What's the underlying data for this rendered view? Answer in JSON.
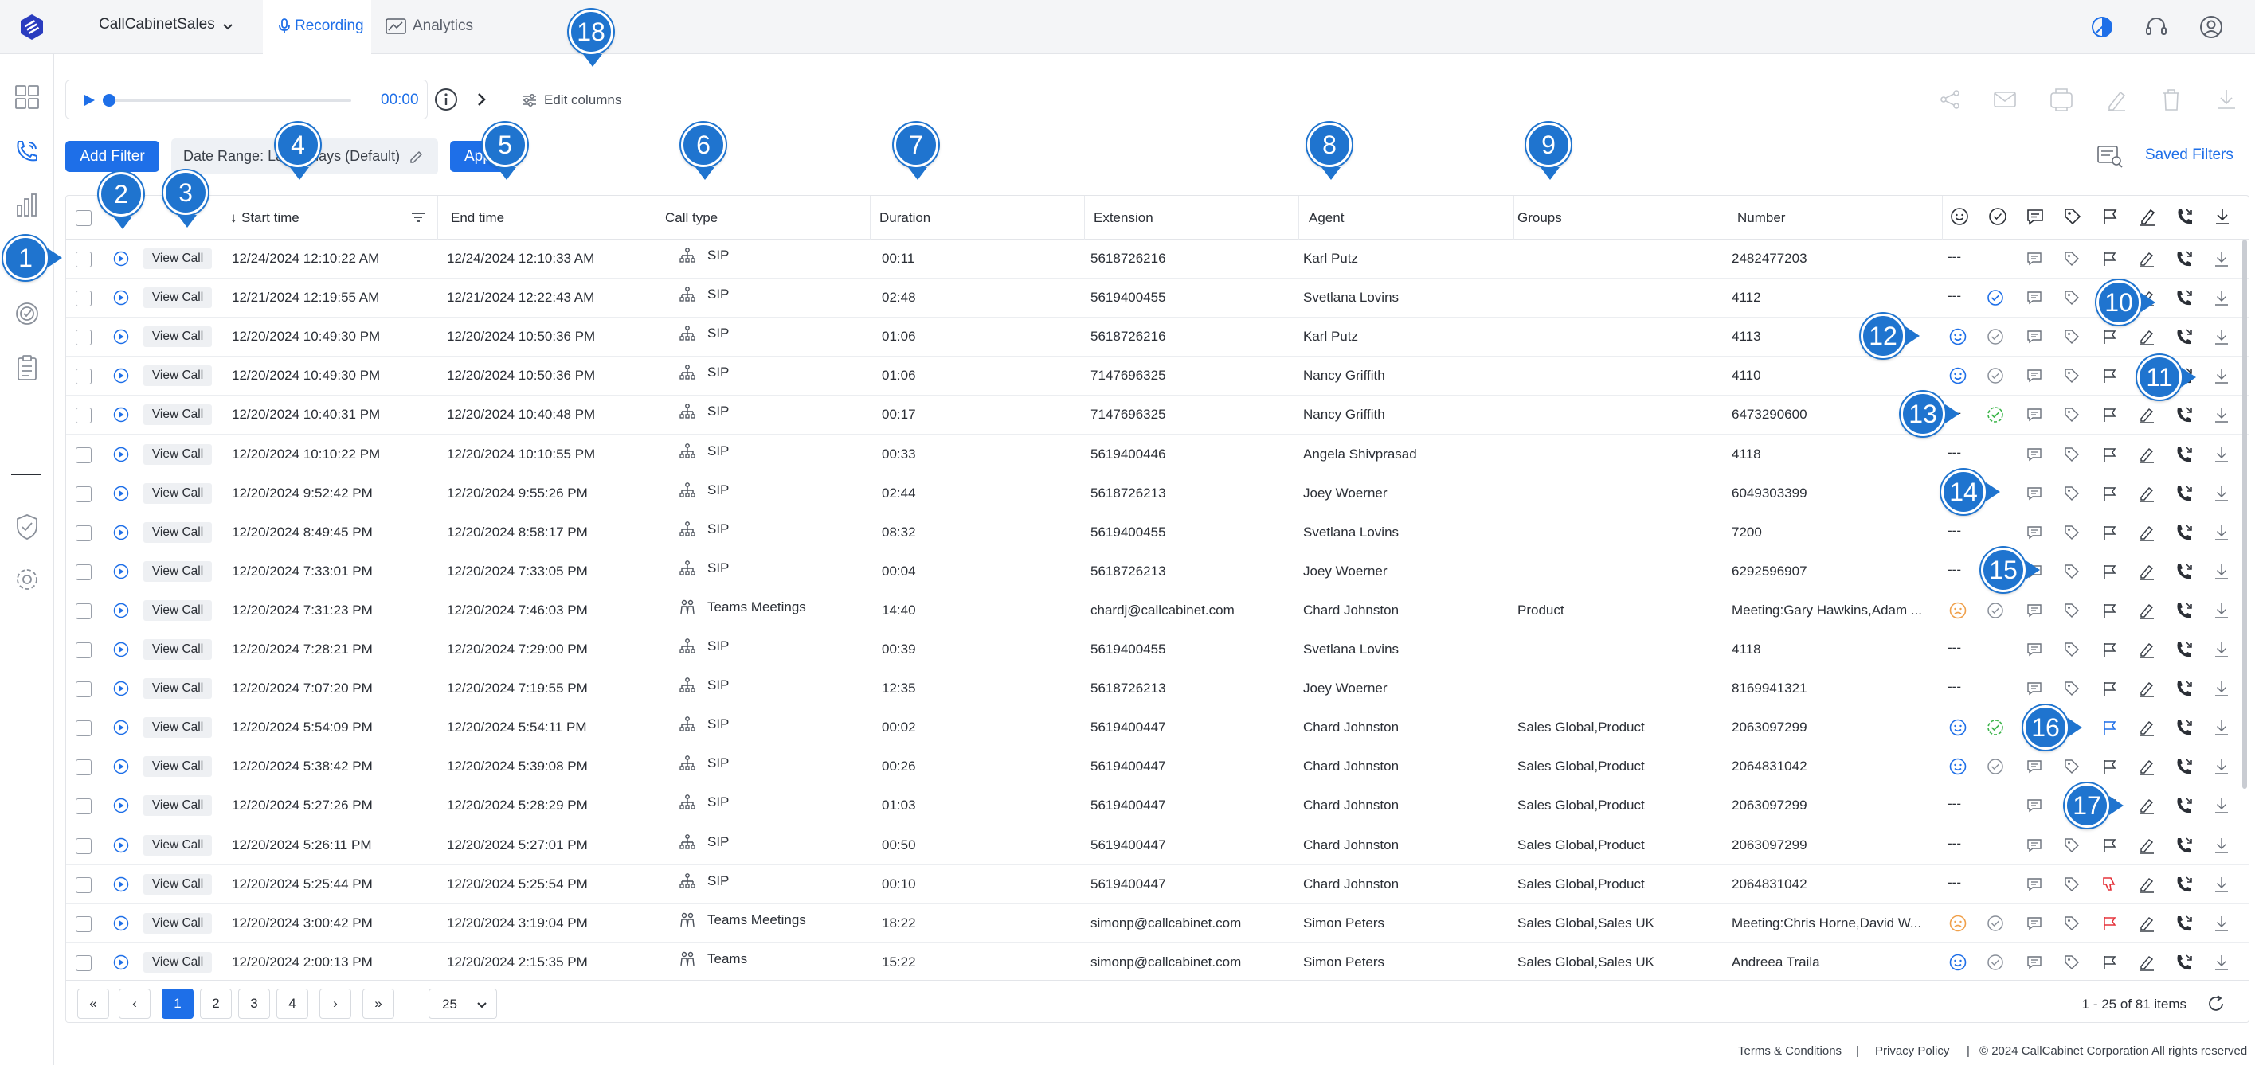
{
  "topbar": {
    "org_name": "CallCabinetSales",
    "tabs": [
      {
        "label": "Recording",
        "active": true
      },
      {
        "label": "Analytics",
        "active": false
      }
    ],
    "right_icons": [
      "theme-toggle-icon",
      "headset-icon",
      "user-account-icon"
    ]
  },
  "sidenav": {
    "items": [
      "dashboard-grid-icon",
      "calls-icon",
      "bar-chart-icon",
      "waveform-icon",
      "quality-check-icon",
      "clipboard-icon",
      "divider",
      "shield-check-icon",
      "settings-gear-icon"
    ]
  },
  "player": {
    "time": "00:00"
  },
  "toolbar": {
    "edit_columns": "Edit columns",
    "action_icons": [
      "share-icon",
      "email-icon",
      "export-xlsx-icon",
      "annotate-icon",
      "delete-icon",
      "download-icon"
    ]
  },
  "filters": {
    "add_filter": "Add Filter",
    "date_range": "Date Range: Last 7 days (Default)",
    "apply": "Apply",
    "saved_filters": "Saved Filters"
  },
  "table": {
    "columns": [
      "Start time",
      "End time",
      "Call type",
      "Duration",
      "Extension",
      "Agent",
      "Groups",
      "Number"
    ],
    "sort_indicator": "↓",
    "rows": [
      {
        "start": "12/24/2024 12:10:22 AM",
        "end": "12/24/2024 12:10:33 AM",
        "type": "SIP",
        "duration": "00:11",
        "extension": "5618726216",
        "agent": "Karl Putz",
        "groups": "",
        "number": "2482477203",
        "sentiment": "",
        "status": "none"
      },
      {
        "start": "12/21/2024 12:19:55 AM",
        "end": "12/21/2024 12:22:43 AM",
        "type": "SIP",
        "duration": "02:48",
        "extension": "5619400455",
        "agent": "Svetlana Lovins",
        "groups": "",
        "number": "4112",
        "sentiment": "",
        "status": "blue"
      },
      {
        "start": "12/20/2024 10:49:30 PM",
        "end": "12/20/2024 10:50:36 PM",
        "type": "SIP",
        "duration": "01:06",
        "extension": "5618726216",
        "agent": "Karl Putz",
        "groups": "",
        "number": "4113",
        "sentiment": "neutral",
        "status": "grey"
      },
      {
        "start": "12/20/2024 10:49:30 PM",
        "end": "12/20/2024 10:50:36 PM",
        "type": "SIP",
        "duration": "01:06",
        "extension": "7147696325",
        "agent": "Nancy Griffith",
        "groups": "",
        "number": "4110",
        "sentiment": "neutral",
        "status": "grey"
      },
      {
        "start": "12/20/2024 10:40:31 PM",
        "end": "12/20/2024 10:40:48 PM",
        "type": "SIP",
        "duration": "00:17",
        "extension": "7147696325",
        "agent": "Nancy Griffith",
        "groups": "",
        "number": "6473290600",
        "sentiment": "",
        "status": "green"
      },
      {
        "start": "12/20/2024 10:10:22 PM",
        "end": "12/20/2024 10:10:55 PM",
        "type": "SIP",
        "duration": "00:33",
        "extension": "5619400446",
        "agent": "Angela Shivprasad",
        "groups": "",
        "number": "4118",
        "sentiment": "",
        "status": "none"
      },
      {
        "start": "12/20/2024 9:52:42 PM",
        "end": "12/20/2024 9:55:26 PM",
        "type": "SIP",
        "duration": "02:44",
        "extension": "5618726213",
        "agent": "Joey Woerner",
        "groups": "",
        "number": "6049303399",
        "sentiment": "",
        "status": "none"
      },
      {
        "start": "12/20/2024 8:49:45 PM",
        "end": "12/20/2024 8:58:17 PM",
        "type": "SIP",
        "duration": "08:32",
        "extension": "5619400455",
        "agent": "Svetlana Lovins",
        "groups": "",
        "number": "7200",
        "sentiment": "",
        "status": "none"
      },
      {
        "start": "12/20/2024 7:33:01 PM",
        "end": "12/20/2024 7:33:05 PM",
        "type": "SIP",
        "duration": "00:04",
        "extension": "5618726213",
        "agent": "Joey Woerner",
        "groups": "",
        "number": "6292596907",
        "sentiment": "",
        "status": "none"
      },
      {
        "start": "12/20/2024 7:31:23 PM",
        "end": "12/20/2024 7:46:03 PM",
        "type": "Teams Meetings",
        "duration": "14:40",
        "extension": "chardj@callcabinet.com",
        "agent": "Chard Johnston",
        "groups": "Product",
        "number": "Meeting:Gary Hawkins,Adam ...",
        "sentiment": "orange",
        "status": "grey"
      },
      {
        "start": "12/20/2024 7:28:21 PM",
        "end": "12/20/2024 7:29:00 PM",
        "type": "SIP",
        "duration": "00:39",
        "extension": "5619400455",
        "agent": "Svetlana Lovins",
        "groups": "",
        "number": "4118",
        "sentiment": "",
        "status": "none"
      },
      {
        "start": "12/20/2024 7:07:20 PM",
        "end": "12/20/2024 7:19:55 PM",
        "type": "SIP",
        "duration": "12:35",
        "extension": "5618726213",
        "agent": "Joey Woerner",
        "groups": "",
        "number": "8169941321",
        "sentiment": "",
        "status": "none"
      },
      {
        "start": "12/20/2024 5:54:09 PM",
        "end": "12/20/2024 5:54:11 PM",
        "type": "SIP",
        "duration": "00:02",
        "extension": "5619400447",
        "agent": "Chard Johnston",
        "groups": "Sales Global,Product",
        "number": "2063097299",
        "sentiment": "neutral",
        "status": "green"
      },
      {
        "start": "12/20/2024 5:38:42 PM",
        "end": "12/20/2024 5:39:08 PM",
        "type": "SIP",
        "duration": "00:26",
        "extension": "5619400447",
        "agent": "Chard Johnston",
        "groups": "Sales Global,Product",
        "number": "2064831042",
        "sentiment": "neutral",
        "status": "grey"
      },
      {
        "start": "12/20/2024 5:27:26 PM",
        "end": "12/20/2024 5:28:29 PM",
        "type": "SIP",
        "duration": "01:03",
        "extension": "5619400447",
        "agent": "Chard Johnston",
        "groups": "Sales Global,Product",
        "number": "2063097299",
        "sentiment": "",
        "status": "none"
      },
      {
        "start": "12/20/2024 5:26:11 PM",
        "end": "12/20/2024 5:27:01 PM",
        "type": "SIP",
        "duration": "00:50",
        "extension": "5619400447",
        "agent": "Chard Johnston",
        "groups": "Sales Global,Product",
        "number": "2063097299",
        "sentiment": "",
        "status": "none"
      },
      {
        "start": "12/20/2024 5:25:44 PM",
        "end": "12/20/2024 5:25:54 PM",
        "type": "SIP",
        "duration": "00:10",
        "extension": "5619400447",
        "agent": "Chard Johnston",
        "groups": "Sales Global,Product",
        "number": "2064831042",
        "sentiment": "",
        "status": "none"
      },
      {
        "start": "12/20/2024 3:00:42 PM",
        "end": "12/20/2024 3:19:04 PM",
        "type": "Teams Meetings",
        "duration": "18:22",
        "extension": "simonp@callcabinet.com",
        "agent": "Simon Peters",
        "groups": "Sales Global,Sales UK",
        "number": "Meeting:Chris Horne,David W...",
        "sentiment": "orange",
        "status": "grey"
      },
      {
        "start": "12/20/2024 2:00:13 PM",
        "end": "12/20/2024 2:15:35 PM",
        "type": "Teams",
        "duration": "15:22",
        "extension": "simonp@callcabinet.com",
        "agent": "Simon Peters",
        "groups": "Sales Global,Sales UK",
        "number": "Andreea Traila",
        "sentiment": "neutral",
        "status": "grey"
      }
    ],
    "view_call_label": "View Call",
    "empty_sentiment": "---"
  },
  "pager": {
    "pages": [
      "1",
      "2",
      "3",
      "4"
    ],
    "current": "1",
    "page_size": "25",
    "items_label": "1 - 25 of 81 items"
  },
  "footer": {
    "terms": "Terms & Conditions",
    "sep": "|",
    "privacy": "Privacy Policy",
    "copyright": "© 2024 CallCabinet Corporation All rights reserved"
  },
  "callouts": [
    "1",
    "2",
    "3",
    "4",
    "5",
    "6",
    "7",
    "8",
    "9",
    "10",
    "11",
    "12",
    "13",
    "14",
    "15",
    "16",
    "17",
    "18"
  ],
  "colors": {
    "accent": "#1e6fe8",
    "callout": "#1f74cf",
    "green": "#3cb54a",
    "orange": "#f0a04b",
    "red": "#e5333b"
  }
}
